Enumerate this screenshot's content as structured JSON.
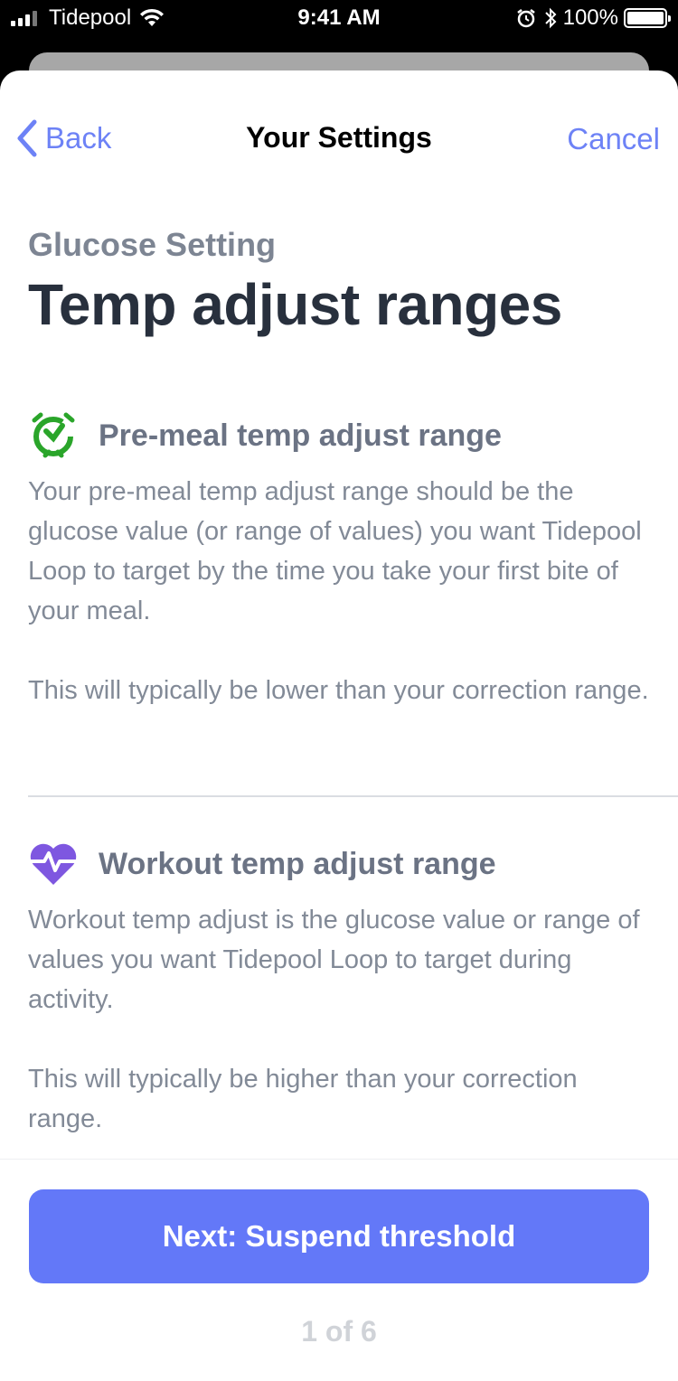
{
  "status_bar": {
    "carrier": "Tidepool",
    "time": "9:41 AM",
    "battery": "100%",
    "battery_level": 1.0,
    "icons": [
      "signal-icon",
      "wifi-icon",
      "alarm-icon",
      "bluetooth-icon",
      "battery-icon"
    ]
  },
  "nav": {
    "back_label": "Back",
    "title": "Your Settings",
    "cancel_label": "Cancel"
  },
  "header": {
    "eyebrow": "Glucose Setting",
    "title": "Temp adjust ranges"
  },
  "sections": [
    {
      "icon": "pre-meal-timer-icon",
      "icon_color": "#2aa52a",
      "title": "Pre-meal temp adjust range",
      "paragraphs": [
        "Your pre-meal temp adjust range should be the glucose value (or range of values) you want Tidepool Loop to target by the time you take your first bite of your meal.",
        "This will typically be lower than your correction range."
      ]
    },
    {
      "icon": "workout-heart-icon",
      "icon_color": "#7e57e0",
      "title": "Workout temp adjust range",
      "paragraphs": [
        "Workout temp adjust is the glucose value or range of values you want Tidepool Loop to target during activity.",
        "This will typically be higher than your correction range."
      ]
    }
  ],
  "footer": {
    "next_label": "Next: Suspend threshold",
    "step": "1 of 6"
  },
  "colors": {
    "accent": "#6378f8",
    "link": "#6d82f6"
  }
}
